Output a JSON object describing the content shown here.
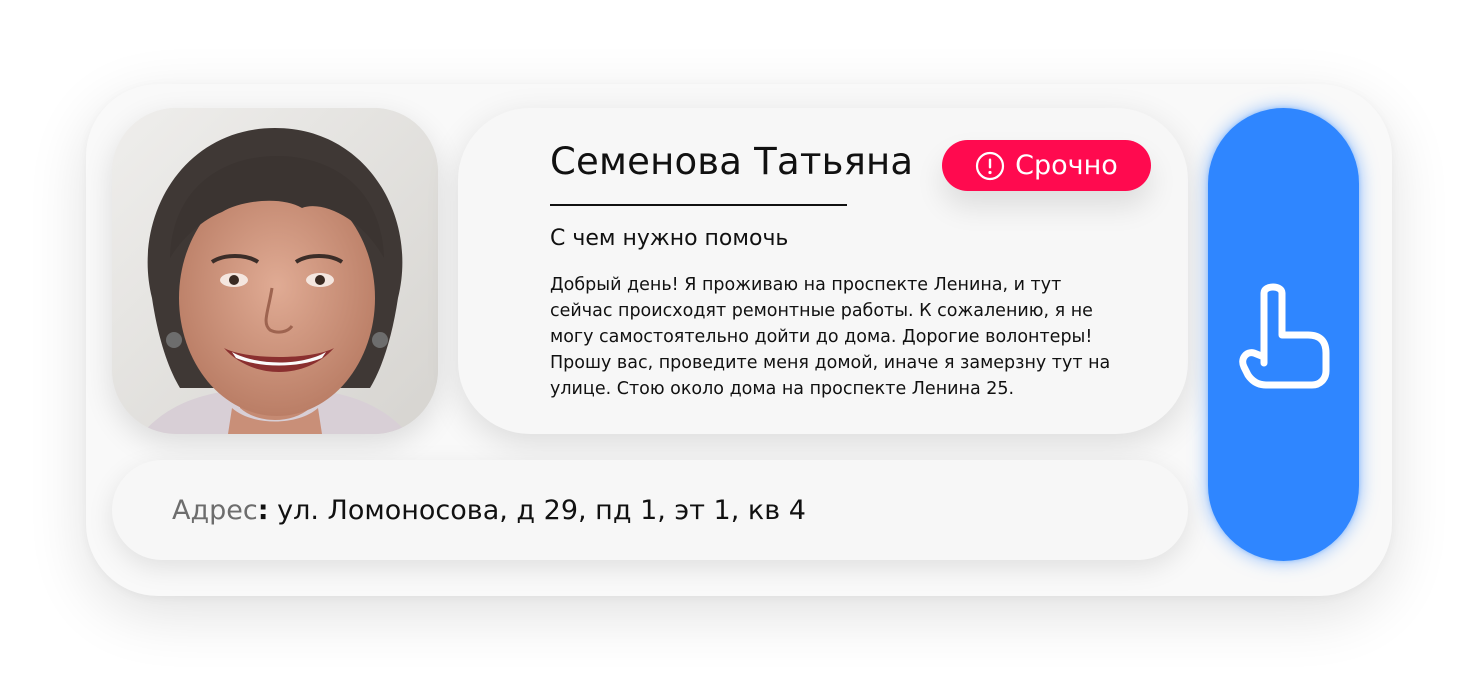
{
  "person": {
    "name": "Семенова Татьяна",
    "photo_alt": "photo"
  },
  "badge": {
    "label": "Срочно",
    "icon": "exclamation-circle-icon",
    "color": "#ff0a4f"
  },
  "request": {
    "section_title": "С чем нужно помочь",
    "message_lines": [
      "Добрый день! Я проживаю на проспекте Ленина, и тут",
      "сейчас происходят ремонтные работы. К сожалению, я не",
      "могу самостоятельно дойти до дома. Дорогие волонтеры!",
      "Прошу вас, проведите меня домой, иначе я замерзну тут на",
      "улице. Стою около дома на проспекте Ленина 25."
    ]
  },
  "address": {
    "label": "Адрес",
    "colon": ":",
    "value": " ул. Ломоносова, д 29, пд 1, эт 1, кв 4"
  },
  "action": {
    "icon": "pointing-hand-icon",
    "color": "#2f86ff"
  }
}
